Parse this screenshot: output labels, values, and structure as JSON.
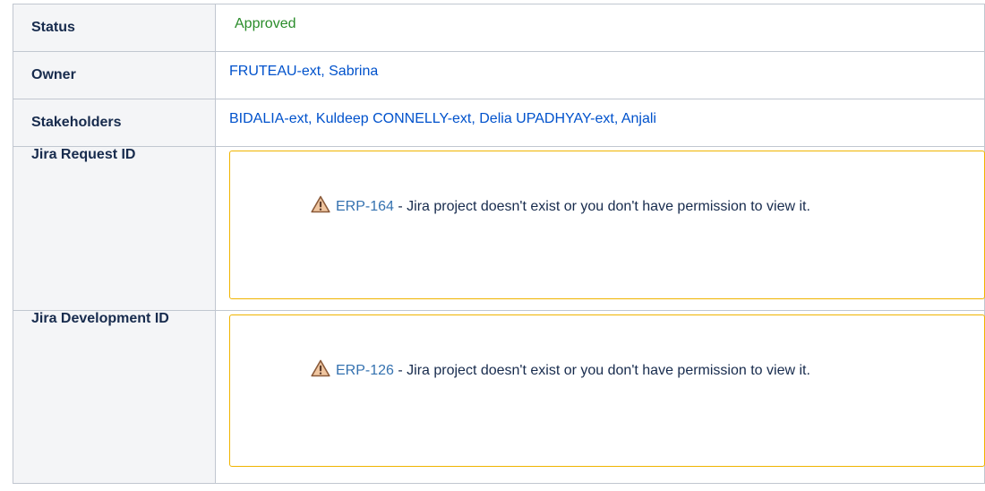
{
  "rows": {
    "status": {
      "label": "Status",
      "value": "Approved",
      "value_color": "#2a8c2a"
    },
    "owner": {
      "label": "Owner",
      "value": "FRUTEAU-ext, Sabrina"
    },
    "stakeholders": {
      "label": "Stakeholders",
      "users": [
        "BIDALIA-ext, Kuldeep",
        "CONNELLY-ext, Delia",
        "UPADHYAY-ext, Anjali"
      ]
    },
    "jira_request": {
      "label": "Jira Request ID",
      "key": "ERP-164",
      "message": " - Jira project doesn't exist or you don't have permission to view it.",
      "icon": "warning-icon"
    },
    "jira_development": {
      "label": "Jira Development ID",
      "key": "ERP-126",
      "message": " - Jira project doesn't exist or you don't have permission to view it.",
      "icon": "warning-icon"
    }
  },
  "colors": {
    "link": "#0052cc",
    "warning_border": "#f0b400",
    "header_bg": "#f4f5f7"
  }
}
